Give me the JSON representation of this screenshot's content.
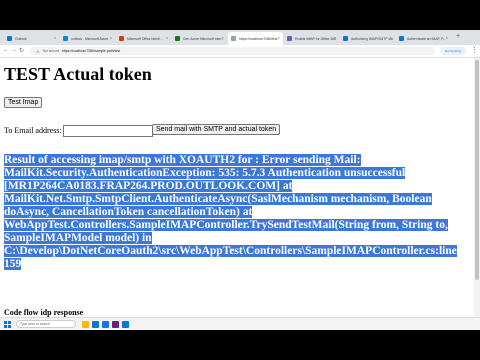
{
  "browser": {
    "tabs": [
      {
        "label": "Outlook",
        "color": "#0078d4"
      },
      {
        "label": "outlook - Microsoft Azure",
        "color": "#0089d6"
      },
      {
        "label": "Microsoft Office Identi...",
        "color": "#d83b01"
      },
      {
        "label": "Get: Azure Microsoft Iden...",
        "color": "#107c10"
      },
      {
        "label": "https://localhost:7086/test",
        "color": "#9aa0a6"
      },
      {
        "label": "Enable IMAP for Office 365",
        "color": "#6264a7"
      },
      {
        "label": "Authorizing IMAP/SMTP via",
        "color": "#0078d4"
      },
      {
        "label": "Authenticate an IMAP, P...",
        "color": "#0078d4"
      }
    ],
    "address": "https://localhost:7086/sample-path/test",
    "security_label": "Not secure",
    "profile_label": "Not Syncing"
  },
  "page": {
    "title": "TEST Actual token",
    "test_imap_label": "Test Imap",
    "email_label": "To Email address:",
    "email_value": "",
    "send_button_label": "Send mail with SMTP and actual token",
    "result_lines": [
      "Result of accessing imap/smtp with XOAUTH2 for : Error sending Mail:",
      "MailKit.Security.AuthenticationException: 535: 5.7.3 Authentication unsuccessful",
      "[MR1P264CA0183.FRAP264.PROD.OUTLOOK.COM] at",
      "MailKit.Net.Smtp.SmtpClient.AuthenticateAsync(SaslMechanism mechanism, Boolean",
      "doAsync, CancellationToken cancellationToken) at",
      "WebAppTest.Controllers.SampleIMAPController.TrySendTestMail(String from, String to,",
      "SampleIMAPModel model) in",
      "C:\\Develop\\DotNetCoreOauth2\\src\\WebAppTest\\Controllers\\SampleIMAPController.cs:line",
      "159"
    ],
    "subheading": "Code flow idp response"
  },
  "taskbar": {
    "search_placeholder": "Type here to search",
    "time": "",
    "date": ""
  }
}
